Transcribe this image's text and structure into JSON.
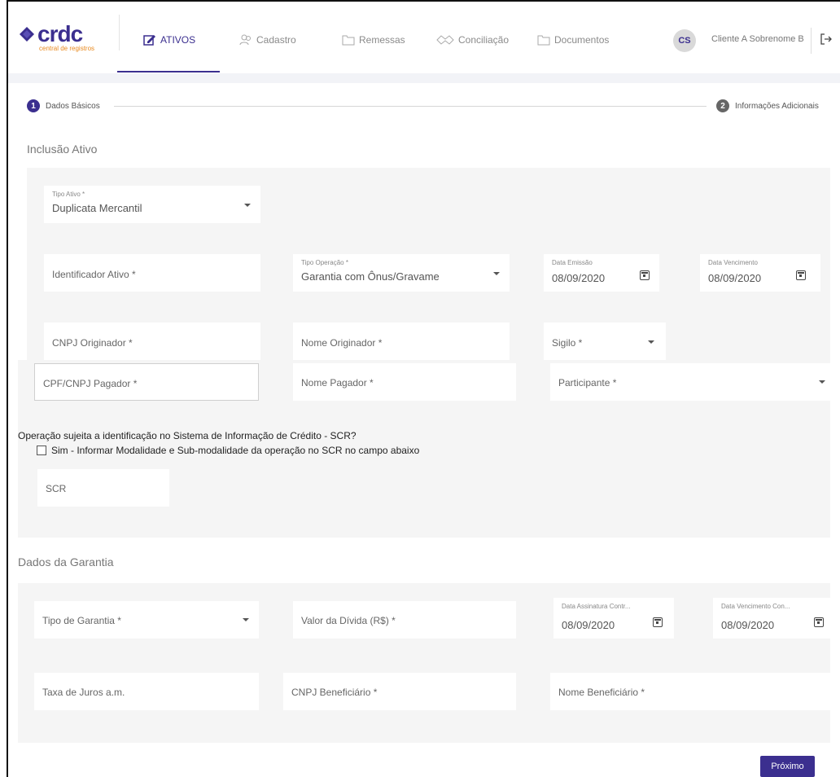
{
  "brand": {
    "logo_text": "crdc",
    "logo_subtitle": "central de registros",
    "logo_color": "#3b2f8f",
    "accent_color": "#e8891e"
  },
  "nav": {
    "items": [
      {
        "label": "ATIVOS",
        "icon": "edit-document-icon",
        "active": true
      },
      {
        "label": "Cadastro",
        "icon": "users-icon",
        "active": false
      },
      {
        "label": "Remessas",
        "icon": "folder-icon",
        "active": false
      },
      {
        "label": "Conciliação",
        "icon": "handshake-icon",
        "active": false
      },
      {
        "label": "Documentos",
        "icon": "folder-icon",
        "active": false
      }
    ]
  },
  "user": {
    "initials": "CS",
    "name": "Cliente A Sobrenome B",
    "logout_icon": "logout-icon"
  },
  "stepper": {
    "steps": [
      {
        "number": "1",
        "label": "Dados Básicos",
        "active": true
      },
      {
        "number": "2",
        "label": "Informações Adicionais",
        "active": false
      }
    ]
  },
  "inclusao": {
    "title": "Inclusão Ativo",
    "tipo_ativo": {
      "label": "Tipo Ativo *",
      "value": "Duplicata Mercantil"
    },
    "identificador_ativo": {
      "placeholder": "Identificador Ativo *"
    },
    "tipo_operacao": {
      "label": "Tipo Operação *",
      "value": "Garantia com Ônus/Gravame"
    },
    "data_emissao": {
      "label": "Data Emissão",
      "value": "08/09/2020"
    },
    "data_vencimento": {
      "label": "Data Vencimento",
      "value": "08/09/2020"
    },
    "cnpj_originador": {
      "placeholder": "CNPJ Originador *"
    },
    "nome_originador": {
      "placeholder": "Nome Originador *"
    },
    "sigilo": {
      "placeholder": "Sigilo *"
    },
    "cpf_cnpj_pagador": {
      "placeholder": "CPF/CNPJ Pagador *"
    },
    "nome_pagador": {
      "placeholder": "Nome Pagador *"
    },
    "participante": {
      "placeholder": "Participante *"
    },
    "scr_question": "Operação sujeita a identificação no Sistema de Informação de Crédito - SCR?",
    "scr_checkbox_label": "Sim - Informar Modalidade e Sub-modalidade da operação no SCR no campo abaixo",
    "scr_checked": false,
    "scr": {
      "placeholder": "SCR"
    }
  },
  "garantia": {
    "title": "Dados da Garantia",
    "tipo_garantia": {
      "placeholder": "Tipo de Garantia *"
    },
    "valor_divida": {
      "placeholder": "Valor da Dívida (R$) *"
    },
    "data_assinatura": {
      "label": "Data Assinatura Contr...",
      "value": "08/09/2020"
    },
    "data_vencimento_con": {
      "label": "Data Vencimento Con...",
      "value": "08/09/2020"
    },
    "taxa_juros": {
      "placeholder": "Taxa de Juros a.m."
    },
    "cnpj_beneficiario": {
      "placeholder": "CNPJ Beneficiário *"
    },
    "nome_beneficiario": {
      "placeholder": "Nome Beneficiário *"
    }
  },
  "actions": {
    "next_label": "Próximo"
  }
}
